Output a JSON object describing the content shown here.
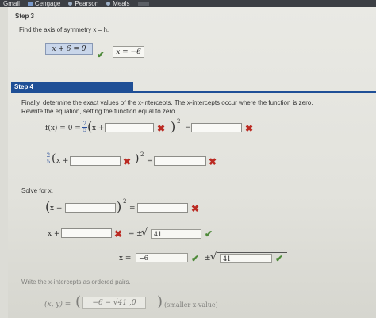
{
  "topbar": {
    "items": [
      "Gmail",
      "Cengage",
      "Pearson",
      "Meals"
    ]
  },
  "step3": {
    "label": "Step 3",
    "instruction": "Find the axis of symmetry x = h.",
    "equation": "x + 6 = 0",
    "answer": "x = −6"
  },
  "step4": {
    "label": "Step 4",
    "line1": "Finally, determine the exact values of the x-intercepts. The x-intercepts occur where the function is zero.",
    "line2": "Rewrite the equation, setting the function equal to zero.",
    "eq1_prefix": "f(x) = 0 =",
    "frac_num": "2",
    "frac_den": "5",
    "x_plus": "x +",
    "exp2": "2",
    "minus": "−",
    "solve_label": "Solve for x.",
    "pm": "±",
    "x_eq": "x =",
    "x_plus_only": "x +",
    "eq_sign": "=",
    "sqrt_val": "41",
    "x_val": "−6",
    "ordered_label": "Write the x-intercepts as ordered pairs.",
    "ordered_prefix": "(x, y) =",
    "ordered_value": "−6 − √41 ,0",
    "smaller_note": "(smaller x-value)"
  },
  "colors": {
    "step_tab": "#1f4f96",
    "check": "#4e8a3a",
    "wrong": "#bb2a22"
  }
}
